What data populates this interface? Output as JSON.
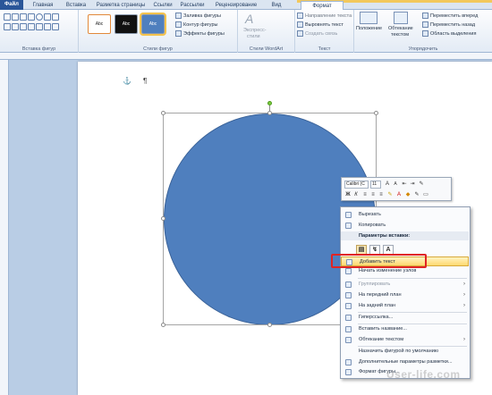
{
  "tabs": [
    {
      "label": "Файл"
    },
    {
      "label": "Главная"
    },
    {
      "label": "Вставка"
    },
    {
      "label": "Разметка страницы"
    },
    {
      "label": "Ссылки"
    },
    {
      "label": "Рассылки"
    },
    {
      "label": "Рецензирование"
    },
    {
      "label": "Вид"
    },
    {
      "label": "Формат"
    }
  ],
  "ribbon": {
    "insert_shapes_label": "Вставка фигур",
    "shape_styles_label": "Стили фигур",
    "wordart_label": "Стили WordArt",
    "text_label": "Текст",
    "arrange_label": "Упорядочить",
    "style_sample": "Abc",
    "fill": "Заливка фигуры",
    "outline": "Контур фигуры",
    "effects": "Эффекты фигуры",
    "express_styles_1": "Экспресс-",
    "express_styles_2": "стили",
    "text_direction": "Направление текста",
    "align_text": "Выровнять текст",
    "create_link": "Создать связь",
    "position": "Положение",
    "wrap_1": "Обтекание",
    "wrap_2": "текстом",
    "bring_forward": "Переместить вперед",
    "send_backward": "Переместить назад",
    "selection_pane": "Область выделения"
  },
  "mini_toolbar": {
    "font": "Calibri (C",
    "size": "11"
  },
  "context_menu": {
    "cut": "Вырезать",
    "copy": "Копировать",
    "paste_options": "Параметры вставки:",
    "add_text": "Добавить текст",
    "edit_points": "Начать изменение узлов",
    "group": "Группировать",
    "bring_to_front": "На передний план",
    "send_to_back": "На задний план",
    "hyperlink": "Гиперссылка...",
    "insert_caption": "Вставить название...",
    "wrap_text": "Обтекание текстом",
    "set_default": "Назначить фигурой по умолчанию",
    "more_layout": "Дополнительные параметры разметки...",
    "format_shape": "Формат фигуры..."
  },
  "watermark": "User-life.com",
  "colors": {
    "shape_fill": "#4f7fbe",
    "file_tab": "#2a5699",
    "highlight": "#ffd96f",
    "callout": "#e02424"
  }
}
